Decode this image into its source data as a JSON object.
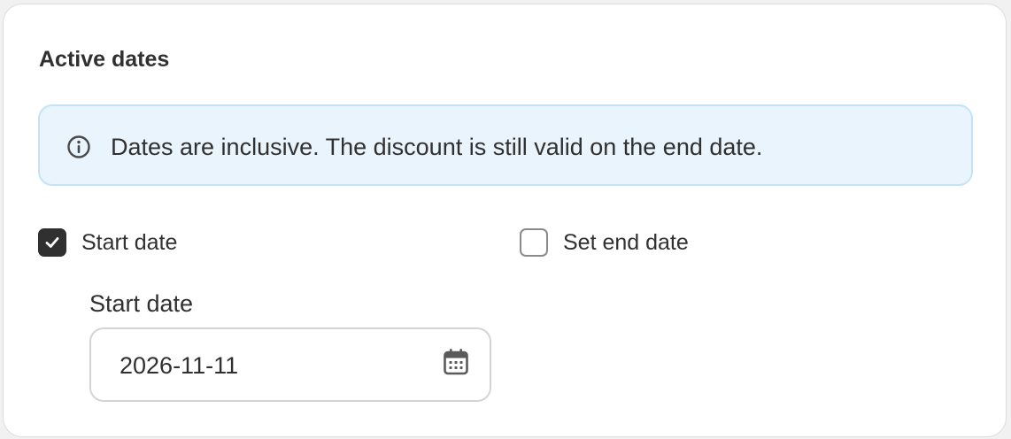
{
  "section": {
    "title": "Active dates"
  },
  "banner": {
    "icon": "info-icon",
    "text": "Dates are inclusive. The discount is still valid on the end date."
  },
  "start_date_checkbox": {
    "label": "Start date",
    "checked": true
  },
  "end_date_checkbox": {
    "label": "Set end date",
    "checked": false
  },
  "start_date_field": {
    "label": "Start date",
    "value": "2026-11-11",
    "icon": "calendar-icon"
  },
  "colors": {
    "banner_background": "#eaf4fc",
    "banner_border": "#c5e3f8",
    "checkbox_checked": "#303030",
    "text": "#303030"
  }
}
